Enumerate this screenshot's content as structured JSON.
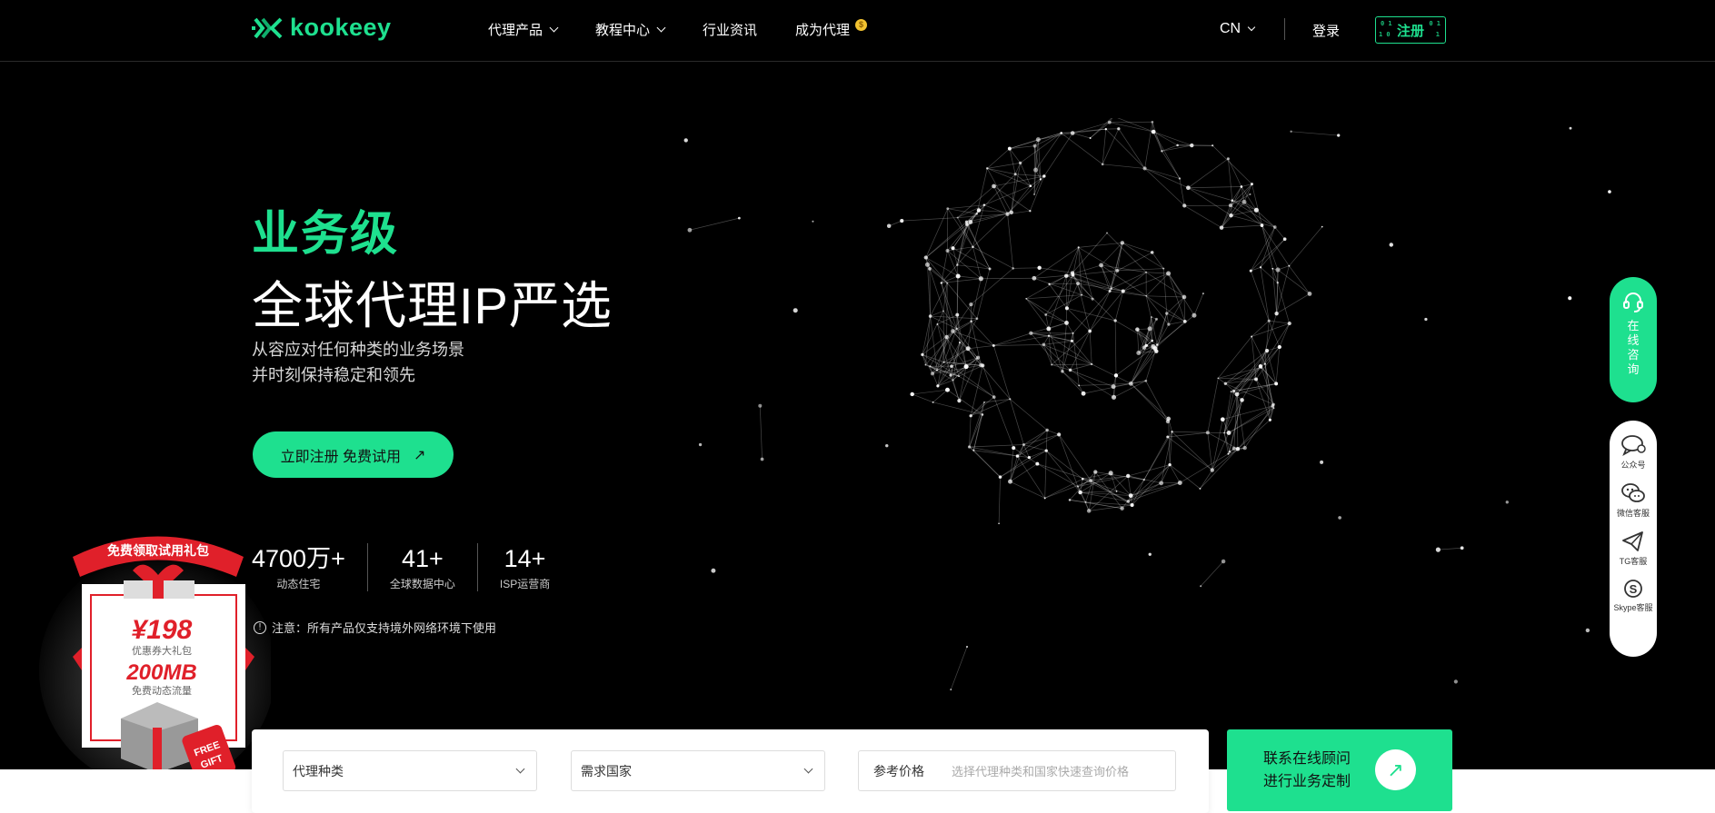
{
  "header": {
    "brand": "kookeey",
    "nav": [
      {
        "label": "代理产品",
        "dropdown": true
      },
      {
        "label": "教程中心",
        "dropdown": true
      },
      {
        "label": "行业资讯",
        "dropdown": false
      },
      {
        "label": "成为代理",
        "dropdown": false,
        "badge": "coin-icon"
      }
    ],
    "language": "CN",
    "login": "登录",
    "register": "注册"
  },
  "hero": {
    "title": "业务级",
    "subtitle": "全球代理IP严选",
    "desc_line1": "从容应对任何种类的业务场景",
    "desc_line2": "并时刻保持稳定和领先",
    "cta": "立即注册 免费试用",
    "stats": [
      {
        "value": "4700万+",
        "label": "动态住宅"
      },
      {
        "value": "41+",
        "label": "全球数据中心"
      },
      {
        "value": "14+",
        "label": "ISP运营商"
      }
    ],
    "notice": "注意：所有产品仅支持境外网络环境下使用"
  },
  "gift": {
    "ribbon": "免费领取试用礼包",
    "price": "¥198",
    "price_desc": "优惠券大礼包",
    "traffic": "200MB",
    "traffic_desc": "免费动态流量",
    "tag_line1": "FREE",
    "tag_line2": "GIFT"
  },
  "float": {
    "online": "在线咨询",
    "items": [
      {
        "label": "公众号",
        "icon": "chat-bubble-icon"
      },
      {
        "label": "微信客服",
        "icon": "wechat-icon"
      },
      {
        "label": "TG客服",
        "icon": "telegram-icon"
      },
      {
        "label": "Skype客服",
        "icon": "skype-icon"
      }
    ]
  },
  "search": {
    "proxy_type": "代理种类",
    "country": "需求国家",
    "price_label": "参考价格",
    "price_placeholder": "选择代理种类和国家快速查询价格"
  },
  "contact": {
    "line1": "联系在线顾问",
    "line2": "进行业务定制"
  },
  "colors": {
    "accent": "#1ee08f",
    "background": "#000000",
    "gift_red": "#e0202a"
  }
}
